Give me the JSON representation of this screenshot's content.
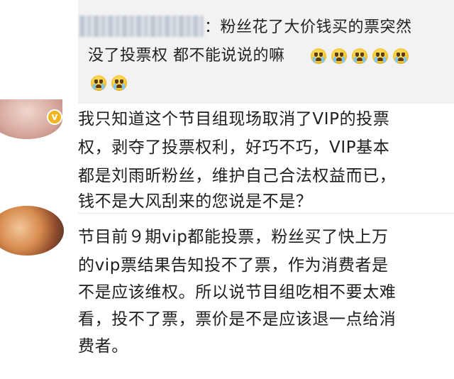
{
  "quoted_comment": {
    "lines": [
      "：粉丝花了大价钱买的票突然",
      "没了投票权 都不能说说的嘛"
    ],
    "emojis": [
      "crying-face",
      "crying-face",
      "crying-face",
      "crying-face",
      "crying-face",
      "crying-face",
      "crying-face"
    ]
  },
  "comments": [
    {
      "verified": true,
      "lines": [
        "我只知道这个节目组现场取消了VIP的投票",
        "权，剥夺了投票权利，好巧不巧，VIP基本",
        "都是刘雨昕粉丝，维护自己合法权益而已，",
        "钱不是大风刮来的您说是不是？"
      ]
    },
    {
      "verified": false,
      "lines": [
        "节目前９期vip都能投票，粉丝买了快上万",
        "的vip票结果告知投不了票，作为消费者是",
        "不是应该维权。所以说节目组吃相不要太难",
        "看，投不了票，票价是不是应该退一点给消",
        "费者。"
      ]
    }
  ],
  "colors": {
    "quote_bg": "#f2f2f2",
    "text": "#1e1e1e",
    "verified_badge": "#f3b51d"
  }
}
